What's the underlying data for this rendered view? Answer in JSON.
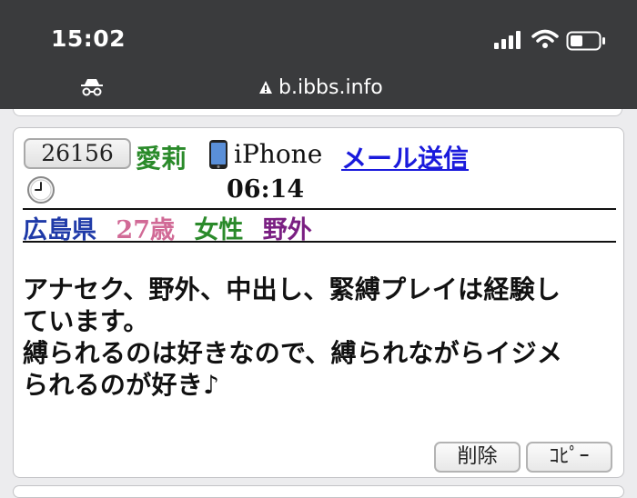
{
  "status_bar": {
    "time": "15:02"
  },
  "browser": {
    "url": "b.ibbs.info"
  },
  "post": {
    "number": "26156",
    "name": "愛莉",
    "device": "iPhone",
    "mail_link": "メール送信",
    "time": "06:14",
    "prefecture": "広島県",
    "age": "27歳",
    "gender": "女性",
    "category": "野外",
    "message_lines": [
      "アナセク、野外、中出し、緊縛プレイは経験し",
      "ています。",
      "縛られるのは好きなので、縛られながらイジメ",
      "られるのが好き♪"
    ],
    "delete_label": "削除",
    "copy_label": "ｺﾋﾟｰ"
  },
  "colors": {
    "name": "#2a8a2a",
    "link": "#1a1adc",
    "prefecture": "#1f3aa8",
    "age": "#d16a96",
    "gender": "#2a8a2a",
    "category": "#7a1f82"
  },
  "icons": {
    "signal": "signal-icon",
    "wifi": "wifi-icon",
    "battery": "battery-icon",
    "incognito": "incognito-icon",
    "warning": "warning-icon",
    "phone": "phone-icon",
    "clock": "clock-icon"
  }
}
